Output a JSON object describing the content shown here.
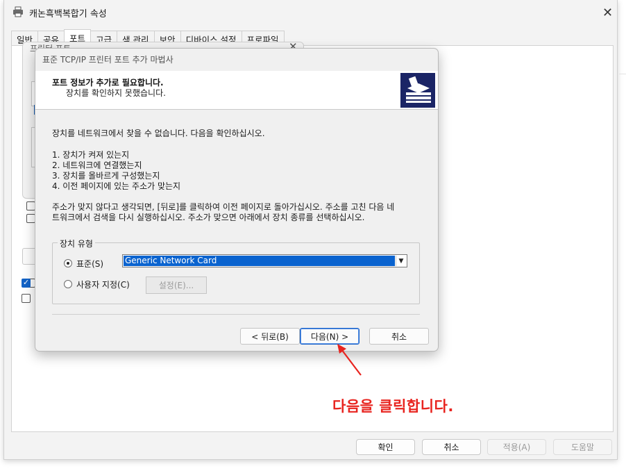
{
  "outer_window": {
    "title": "캐논흑백복합기 속성",
    "tabs": [
      "일반",
      "공유",
      "포트",
      "고급",
      "색 관리",
      "보안",
      "디바이스 설정",
      "프로파일"
    ],
    "buttons": {
      "ok": "확인",
      "cancel": "취소",
      "apply": "적용(A)",
      "help": "도움말"
    }
  },
  "mid_window": {
    "title": "프린터 포트"
  },
  "wizard": {
    "title": "표준 TCP/IP 프린터 포트 추가 마법사",
    "header_title": "포트 정보가 추가로 필요합니다.",
    "header_subtitle": "장치를 확인하지 못했습니다.",
    "intro": "장치를 네트워크에서 찾을 수 없습니다. 다음을 확인하십시오.",
    "checklist": [
      "1.  장치가 켜져 있는지",
      "2.  네트워크에 연결했는지",
      "3.  장치를 올바르게 구성했는지",
      "4.  이전 페이지에 있는 주소가 맞는지"
    ],
    "note_line1": "주소가 맞지 않다고 생각되면, [뒤로]를 클릭하여 이전 페이지로 돌아가십시오. 주소를 고친 다음 네",
    "note_line2": "트워크에서 검색을 다시 실행하십시오. 주소가 맞으면 아래에서 장치 종류를 선택하십시오.",
    "device_type": {
      "legend": "장치 유형",
      "standard_label": "표준(S)",
      "standard_selected": true,
      "standard_value": "Generic Network Card",
      "custom_label": "사용자 지정(C)",
      "settings_label": "설정(E)..."
    },
    "buttons": {
      "back": "< 뒤로(B)",
      "next": "다음(N) >",
      "cancel": "취소"
    }
  },
  "annotation": {
    "text": "다음을 클릭합니다.",
    "color": "#e8241f"
  }
}
